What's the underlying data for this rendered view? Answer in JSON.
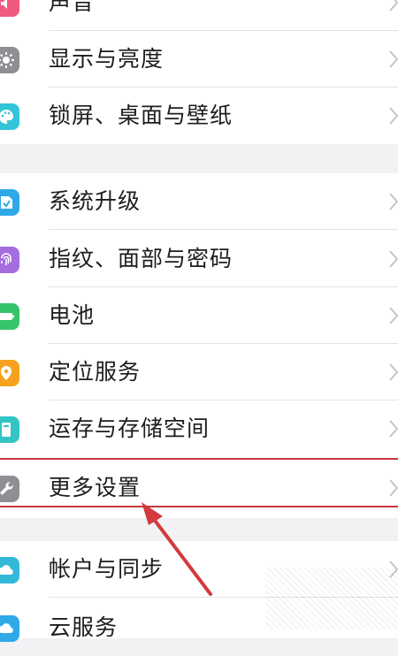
{
  "settings": {
    "items": [
      {
        "label": "声音",
        "icon": "sound-icon",
        "color": "#f05a7e"
      },
      {
        "label": "显示与亮度",
        "icon": "brightness-icon",
        "color": "#8e8e93"
      },
      {
        "label": "锁屏、桌面与壁纸",
        "icon": "palette-icon",
        "color": "#33c4d8"
      },
      {
        "label": "系统升级",
        "icon": "system-update-icon",
        "color": "#2fa8e8"
      },
      {
        "label": "指纹、面部与密码",
        "icon": "fingerprint-icon",
        "color": "#a66ce0"
      },
      {
        "label": "电池",
        "icon": "battery-icon",
        "color": "#35c46a"
      },
      {
        "label": "定位服务",
        "icon": "location-icon",
        "color": "#f6a21f"
      },
      {
        "label": "运存与存储空间",
        "icon": "storage-icon",
        "color": "#33c4c4"
      },
      {
        "label": "更多设置",
        "icon": "wrench-icon",
        "color": "#8e8e93"
      },
      {
        "label": "帐户与同步",
        "icon": "cloud-sync-icon",
        "color": "#33b8d8"
      },
      {
        "label": "云服务",
        "icon": "cloud-service-icon",
        "color": "#2fa8e8"
      }
    ]
  },
  "highlight": {
    "color": "#c8373d",
    "target": "更多设置"
  }
}
